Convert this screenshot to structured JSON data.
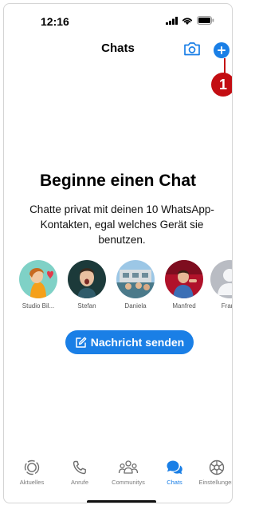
{
  "status": {
    "time": "12:16"
  },
  "nav": {
    "title": "Chats"
  },
  "annotation": {
    "step": "1"
  },
  "empty_state": {
    "heading": "Beginne einen Chat",
    "description": "Chatte privat mit deinen 10 WhatsApp-Kontakten, egal welches Gerät sie benutzen."
  },
  "contacts": [
    {
      "name": "Studio Bil..."
    },
    {
      "name": "Stefan"
    },
    {
      "name": "Daniela"
    },
    {
      "name": "Manfred"
    },
    {
      "name": "Franz"
    }
  ],
  "actions": {
    "send_label": "Nachricht senden"
  },
  "tabs": [
    {
      "label": "Aktuelles",
      "icon": "status-icon"
    },
    {
      "label": "Anrufe",
      "icon": "phone-icon"
    },
    {
      "label": "Communitys",
      "icon": "communities-icon"
    },
    {
      "label": "Chats",
      "icon": "chats-icon",
      "active": true
    },
    {
      "label": "Einstellungen",
      "icon": "settings-icon"
    }
  ],
  "colors": {
    "accent": "#1a7fe6",
    "annotation": "#c30d12"
  }
}
